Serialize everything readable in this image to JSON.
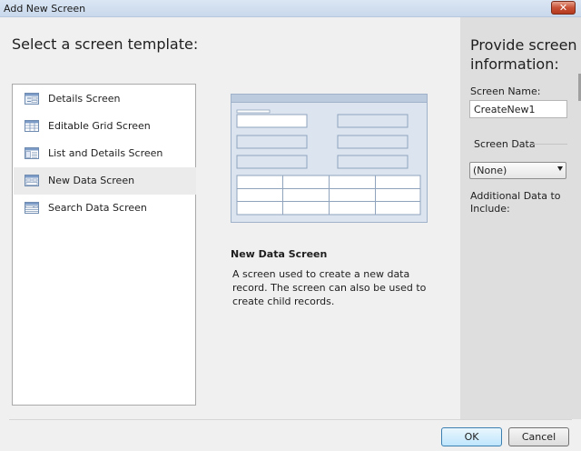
{
  "window": {
    "title": "Add New Screen",
    "close_symbol": "✕"
  },
  "main": {
    "heading": "Select a screen template:",
    "templates": [
      {
        "label": "Details Screen",
        "icon": "details-screen-icon"
      },
      {
        "label": "Editable Grid Screen",
        "icon": "editable-grid-screen-icon"
      },
      {
        "label": "List and Details Screen",
        "icon": "list-details-screen-icon"
      },
      {
        "label": "New Data Screen",
        "icon": "new-data-screen-icon",
        "selected": true
      },
      {
        "label": "Search Data Screen",
        "icon": "search-data-screen-icon"
      }
    ],
    "description": {
      "title": "New Data Screen",
      "text": "A screen used to create a new data record. The screen can also be used to create child records."
    }
  },
  "side": {
    "title": "Provide screen information:",
    "screen_name_label": "Screen Name:",
    "screen_name_value": "CreateNew1",
    "screen_data_label": "Screen Data",
    "screen_data_value": "(None)",
    "additional_label": "Additional Data to Include:"
  },
  "buttons": {
    "ok_label": "OK",
    "cancel_label": "Cancel"
  },
  "colors": {
    "selected_row": "#ebebeb",
    "side_pane": "#dedede",
    "preview_blue": "#d4e0ee"
  }
}
